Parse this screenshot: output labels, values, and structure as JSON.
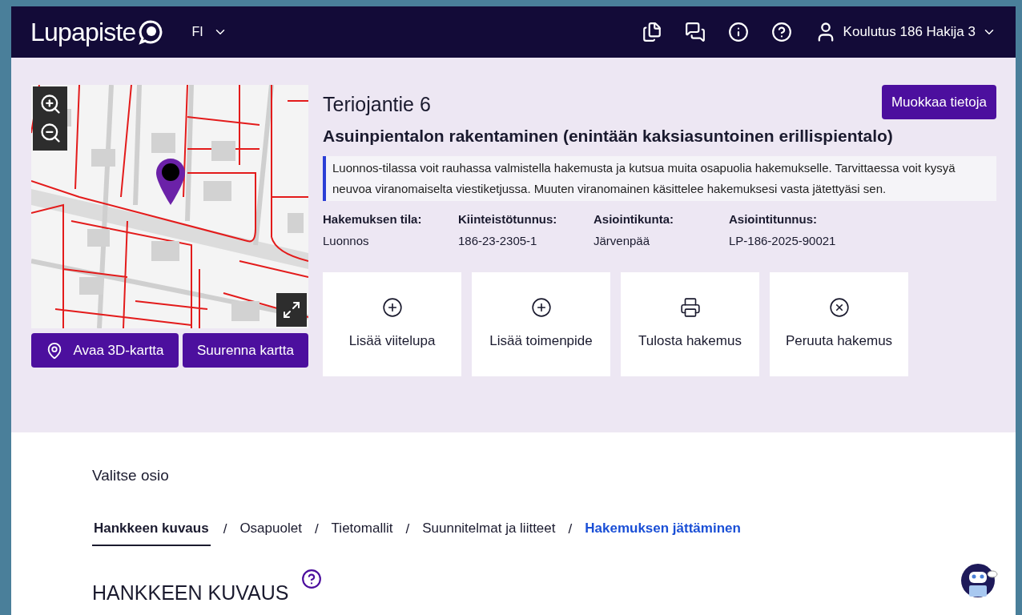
{
  "header": {
    "logo": "Lupapiste",
    "language": "FI",
    "user": "Koulutus 186 Hakija 3"
  },
  "map": {
    "buttons": [
      "Avaa 3D-kartta",
      "Suurenna kartta"
    ]
  },
  "application": {
    "address": "Teriojantie 6",
    "edit_button": "Muokkaa tietoja",
    "operation": "Asuinpientalon rakentaminen (enintään kaksiasuntoinen erillispientalo)",
    "notice": "Luonnos-tilassa voit rauhassa valmistella hakemusta ja kutsua muita osapuolia hakemukselle. Tarvittaessa voit kysyä neuvoa viranomaiselta viestiketjussa. Muuten viranomainen käsittelee hakemuksesi vasta jätettyäsi sen.",
    "details": [
      {
        "label": "Hakemuksen tila:",
        "value": "Luonnos"
      },
      {
        "label": "Kiinteistötunnus:",
        "value": "186-23-2305-1"
      },
      {
        "label": "Asiointikunta:",
        "value": "Järvenpää"
      },
      {
        "label": "Asiointitunnus:",
        "value": "LP-186-2025-90021"
      }
    ],
    "actions": [
      {
        "label": "Lisää viitelupa",
        "kind": "add"
      },
      {
        "label": "Lisää toimenpide",
        "kind": "add"
      },
      {
        "label": "Tulosta hakemus",
        "kind": "print"
      },
      {
        "label": "Peruuta hakemus",
        "kind": "cancel"
      }
    ]
  },
  "sections": {
    "title": "Valitse osio",
    "separator": "/",
    "tabs": [
      {
        "label": "Hankkeen kuvaus",
        "selected": true,
        "highlighted": false
      },
      {
        "label": "Osapuolet",
        "selected": false,
        "highlighted": false
      },
      {
        "label": "Tietomallit",
        "selected": false,
        "highlighted": false
      },
      {
        "label": "Suunnitelmat ja liitteet",
        "selected": false,
        "highlighted": false
      },
      {
        "label": "Hakemuksen jättäminen",
        "selected": false,
        "highlighted": true
      }
    ]
  },
  "content": {
    "heading": "HANKKEEN KUVAUS"
  }
}
